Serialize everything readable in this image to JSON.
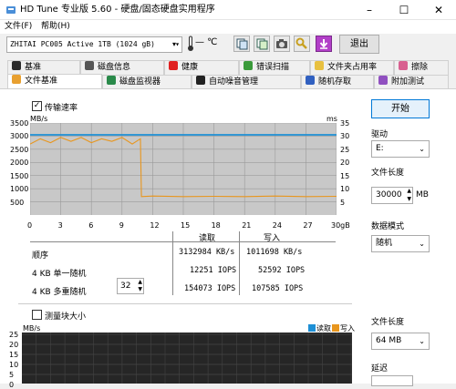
{
  "window": {
    "title": "HD Tune 专业版 5.60 - 硬盘/固态硬盘实用程序",
    "minimize": "–",
    "maximize": "☐",
    "close": "✕"
  },
  "menu": [
    "文件(F)",
    "帮助(H)"
  ],
  "toolbar": {
    "drive": "ZHITAI PC005 Active 1TB (1024 gB)",
    "temperature": "— ℃",
    "exit_label": "退出"
  },
  "tabs_row1": [
    "基准",
    "磁盘信息",
    "健康",
    "错误扫描",
    "文件夹占用率",
    "擦除"
  ],
  "tabs_row2": [
    "文件基准",
    "磁盘监视器",
    "自动噪音管理",
    "随机存取",
    "附加测试"
  ],
  "file_benchmark": {
    "transfer_rate_label": "传输速率",
    "transfer_rate_checked": true,
    "block_size_label": "测量块大小",
    "block_size_checked": false
  },
  "chart_data": [
    {
      "type": "line",
      "yunit_left": "MB/s",
      "yunit_right": "ms",
      "yticks_left": [
        "3500",
        "3000",
        "2500",
        "2000",
        "1500",
        "1000",
        "500"
      ],
      "yticks_right": [
        "35",
        "30",
        "25",
        "20",
        "15",
        "10",
        "5"
      ],
      "xticks": [
        "0",
        "3",
        "6",
        "9",
        "12",
        "15",
        "18",
        "21",
        "24",
        "27",
        "30gB"
      ],
      "ylim": [
        0,
        3500
      ],
      "xlim": [
        0,
        30
      ],
      "series": [
        {
          "color": "#1e8fd5",
          "values": [
            [
              0,
              3050
            ],
            [
              30,
              3050
            ]
          ]
        },
        {
          "color": "#e8961e",
          "values": [
            [
              0,
              2700
            ],
            [
              1,
              2900
            ],
            [
              2,
              2750
            ],
            [
              3,
              2950
            ],
            [
              4,
              2800
            ],
            [
              5,
              2950
            ],
            [
              6,
              2750
            ],
            [
              7,
              2900
            ],
            [
              8,
              2800
            ],
            [
              9,
              2950
            ],
            [
              10,
              2700
            ],
            [
              10.8,
              2900
            ],
            [
              10.9,
              700
            ],
            [
              12,
              720
            ],
            [
              15,
              700
            ],
            [
              18,
              710
            ],
            [
              21,
              700
            ],
            [
              24,
              720
            ],
            [
              27,
              700
            ],
            [
              30,
              710
            ]
          ]
        }
      ]
    },
    {
      "type": "line",
      "yunit_left": "MB/s",
      "yticks_left": [
        "25",
        "20",
        "15",
        "10",
        "5",
        "0"
      ],
      "legend": [
        "读取",
        "写入"
      ],
      "legend_colors": [
        "#1e8fd5",
        "#e8961e"
      ],
      "series": []
    }
  ],
  "results": {
    "col_read": "读取",
    "col_write": "写入",
    "rows": [
      {
        "label": "顺序",
        "read": "3132984 KB/s",
        "write": "1011698 KB/s"
      },
      {
        "label": "4 KB 单一随机",
        "read": "12251 IOPS",
        "write": "52592 IOPS"
      },
      {
        "label": "4 KB 多重随机",
        "read": "154073 IOPS",
        "write": "107585 IOPS"
      }
    ],
    "queue_depth": "32"
  },
  "right_panel": {
    "start_label": "开始",
    "drive_label": "驱动",
    "drive_value": "E:",
    "file_length_label": "文件长度",
    "file_length_value": "30000",
    "file_length_unit": "MB",
    "data_mode_label": "数据模式",
    "data_mode_value": "随机",
    "file_length2_label": "文件长度",
    "file_length2_value": "64 MB",
    "delay_label": "延迟"
  }
}
